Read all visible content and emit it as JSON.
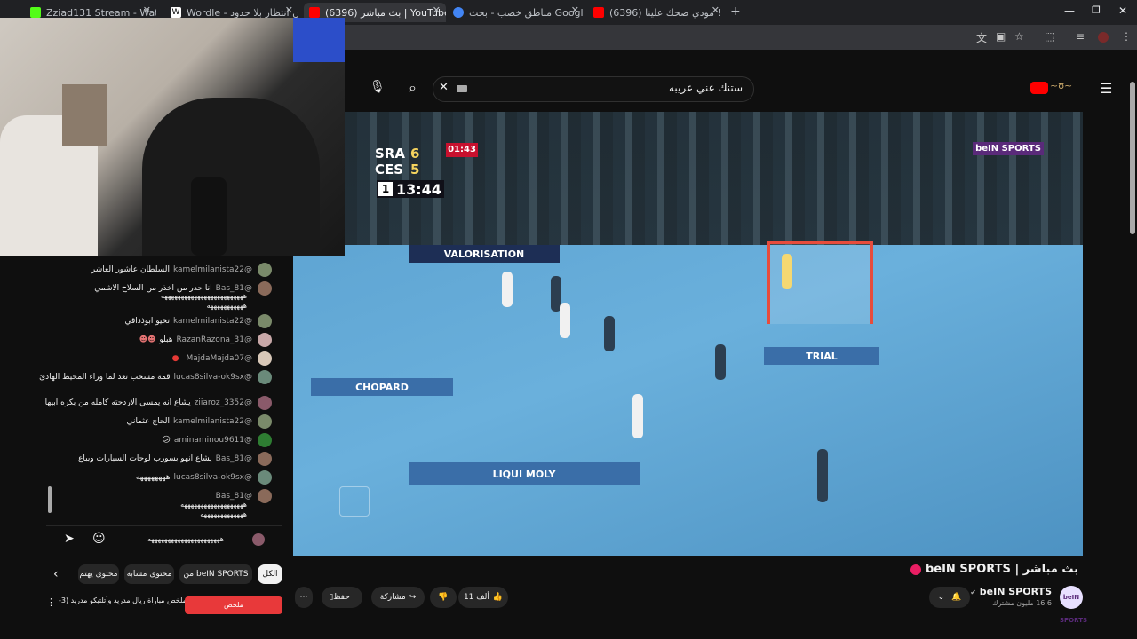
{
  "tabs": [
    {
      "title": "Zziad131 Stream - Watch Live o",
      "favicon_color": "#53fc18",
      "icon": "kick-icon"
    },
    {
      "title": "Wordle - بدون انتظار بلا حدود",
      "favicon_color": "#ffffff",
      "icon": "wordle-icon"
    },
    {
      "title": "(6396) بث مباشر | YouTube",
      "favicon_color": "#ff0000",
      "icon": "youtube-icon"
    },
    {
      "title": "مناطق خصب - بحث Google",
      "favicon_color": "#4285f4",
      "icon": "google-icon"
    },
    {
      "title": "(6396) مودي ضحك علينا ! 😂 💔",
      "favicon_color": "#ff0000",
      "icon": "youtube-icon"
    }
  ],
  "search": {
    "query": "ستنك عني عريبه"
  },
  "scoreboard": {
    "team1": "SRA",
    "score1": "6",
    "team2": "CES",
    "score2": "5",
    "penalty_timer": "01:43",
    "half": "1",
    "clock": "13:44",
    "broadcaster": "beIN SPORTS"
  },
  "chat": {
    "messages": [
      {
        "user": "@kamelmilanista22",
        "text": "السلطان عاشور العاشر"
      },
      {
        "user": "@Bas_81",
        "text": "انا حذر من اخذر من السلاح الاشمي"
      },
      {
        "user": "@kamelmilanista22",
        "text": "تحيو ابوذداقي"
      },
      {
        "user": "@RazanRazona_31",
        "text": "هبلو"
      },
      {
        "user": "@MajdaMajda07",
        "text": ""
      },
      {
        "user": "@lucas8silva-ok9sx",
        "text": "قمة مسخب تعد لما وراء المحيط الهادئ"
      },
      {
        "user": "@ziiaroz_3352",
        "text": "يشاع انه يمسي الاردحته كامله من بكره ابيها"
      },
      {
        "user": "@kamelmilanista22",
        "text": "الحاج عثماني"
      },
      {
        "user": "@aminaminou9611",
        "text": "😕"
      },
      {
        "user": "@Bas_81",
        "text": "يشاع انهو بسورب لوحات السيارات ويباع"
      },
      {
        "user": "@lucas8silva-ok9sx",
        "text": "ههههههههه"
      },
      {
        "user": "@Bas_81",
        "text": ""
      }
    ],
    "wrap_line_1": "هههههههههههههههههههههههههه",
    "wrap_line_2": "هههههههههههه",
    "wrap_line_3": "هههههههههههههههههههههههههههههه",
    "wrap_line_4": "هههههههههه",
    "wrap_line_5": "هههههههههههههههههههه",
    "wrap_line_6": "هههههههههههههه",
    "wrap_line_7": "ههههههههههههههه",
    "input_value": "ههههههههههههههههههههههه"
  },
  "chips": {
    "all": "الكل",
    "from": "من beIN SPORTS",
    "related": "محتوى مشابه",
    "recent": "محتوى يهتم"
  },
  "video": {
    "title": "بث مباشر | beIN SPORTS",
    "likes": "11 ألف",
    "share": "مشاركة",
    "save": "حفظ",
    "channel": "beIN SPORTS",
    "subscribers": "16.6 مليون مشترك",
    "avatar_text": "beIN SPORTS"
  },
  "related_video": {
    "title": "ملخص مباراة ريال مدريد وأتلتيكو مدريد (3-",
    "thumb_label": "ملخص"
  }
}
